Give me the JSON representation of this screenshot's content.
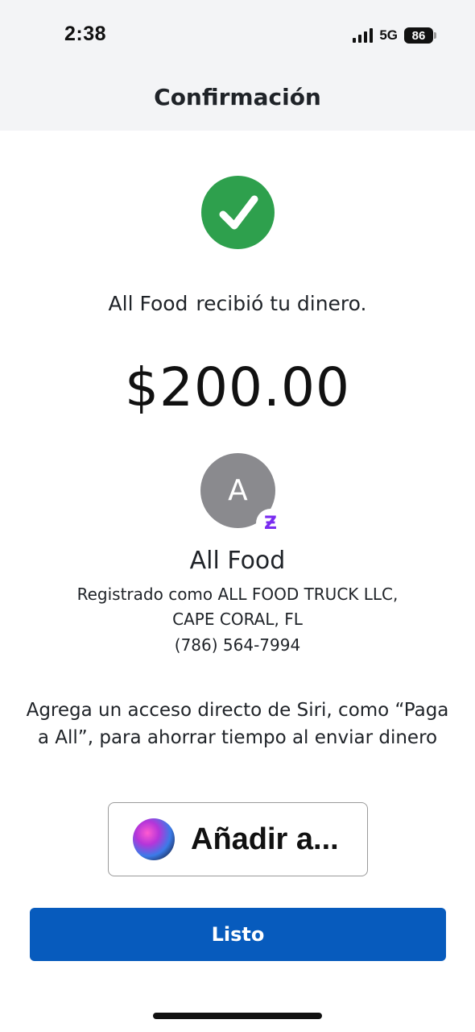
{
  "status_bar": {
    "time": "2:38",
    "network": "5G",
    "battery": "86"
  },
  "header": {
    "title": "Confirmación"
  },
  "confirmation": {
    "recipient_name": "All Food",
    "received_text": "recibió tu dinero.",
    "amount": "$200.00"
  },
  "recipient": {
    "avatar_initial": "A",
    "badge_symbol": "Ƶ",
    "name": "All Food",
    "registered_as": "Registrado como ALL FOOD TRUCK LLC,",
    "location": "CAPE CORAL, FL",
    "phone": "(786) 564-7994"
  },
  "siri": {
    "prompt": "Agrega un acceso directo de Siri, como “Paga a All”, para ahorrar tiempo al enviar dinero",
    "button_label": "Añadir a..."
  },
  "actions": {
    "done_label": "Listo"
  },
  "colors": {
    "success": "#2ea04d",
    "primary_button": "#075bbd",
    "badge": "#7a2cf0",
    "avatar": "#8a8a8e"
  }
}
